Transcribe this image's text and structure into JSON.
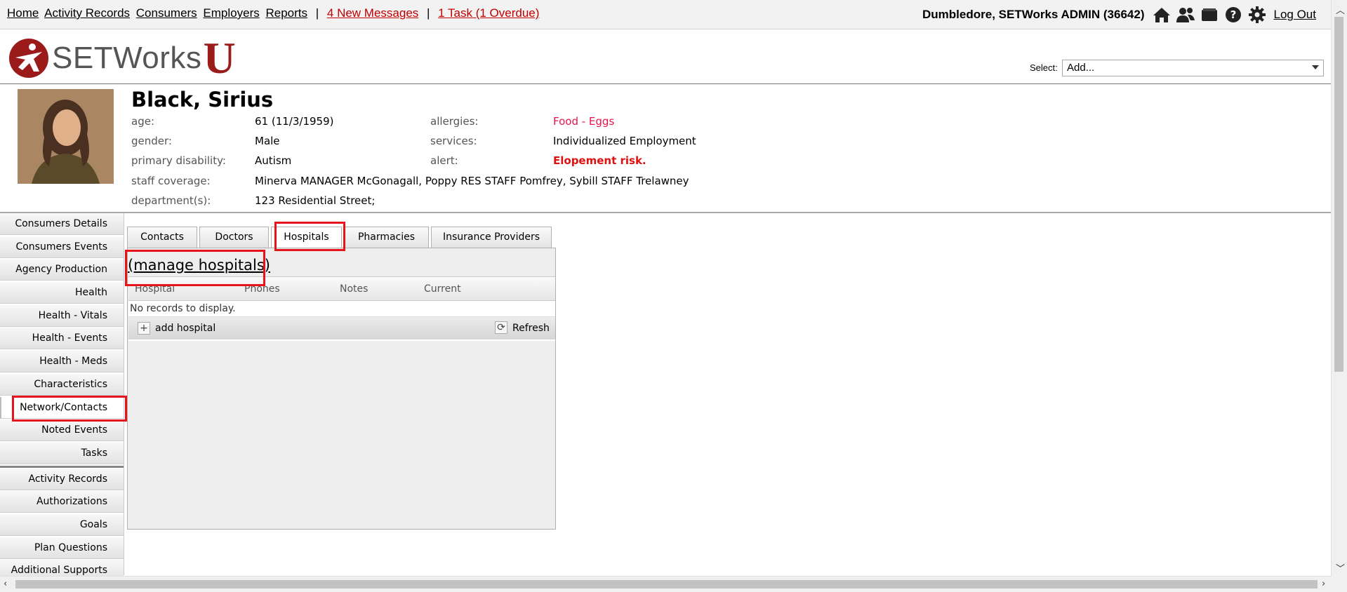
{
  "nav": {
    "links": [
      "Home",
      "Activity Records",
      "Consumers",
      "Employers",
      "Reports"
    ],
    "separator": "|",
    "messages": "4 New Messages",
    "tasks": "1 Task (1 Overdue)"
  },
  "user": {
    "name": "Dumbledore, SETWorks ADMIN",
    "id": "(36642)",
    "logout": "Log Out",
    "icons": [
      "home-icon",
      "users-icon",
      "folder-icon",
      "help-icon",
      "gear-icon"
    ]
  },
  "logo": {
    "text": "SETWorks",
    "suffix": "U"
  },
  "select": {
    "label": "Select:",
    "value": "Add..."
  },
  "consumer": {
    "name": "Black, Sirius",
    "age_label": "age:",
    "age": "61 (11/3/1959)",
    "gender_label": "gender:",
    "gender": "Male",
    "disability_label": "primary disability:",
    "disability": "Autism",
    "staff_label": "staff coverage:",
    "staff": "Minerva MANAGER McGonagall, Poppy RES STAFF Pomfrey, Sybill STAFF Trelawney",
    "dept_label": "department(s):",
    "dept": "123 Residential Street;",
    "allergies_label": "allergies:",
    "allergies": "Food - Eggs",
    "services_label": "services:",
    "services": "Individualized Employment",
    "alert_label": "alert:",
    "alert": "Elopement risk."
  },
  "sidebar": {
    "group1": [
      "Consumers Details",
      "Consumers Events",
      "Agency Production",
      "Health",
      "Health - Vitals",
      "Health - Events",
      "Health - Meds",
      "Characteristics",
      "Network/Contacts",
      "Noted Events",
      "Tasks"
    ],
    "group2": [
      "Activity Records",
      "Authorizations",
      "Goals",
      "Plan Questions",
      "Additional Supports"
    ],
    "active": "Network/Contacts"
  },
  "tabs": [
    "Contacts",
    "Doctors",
    "Hospitals",
    "Pharmacies",
    "Insurance Providers"
  ],
  "active_tab": "Hospitals",
  "panel": {
    "manage_link": "(manage hospitals)",
    "columns": [
      "Hospital",
      "Phones",
      "Notes",
      "Current"
    ],
    "empty_text": "No records to display.",
    "add_label": "add hospital",
    "refresh_label": "Refresh"
  },
  "colors": {
    "accent_red": "#e8141c",
    "logo_red": "#9b1b1b",
    "allergy": "#e8144c"
  }
}
